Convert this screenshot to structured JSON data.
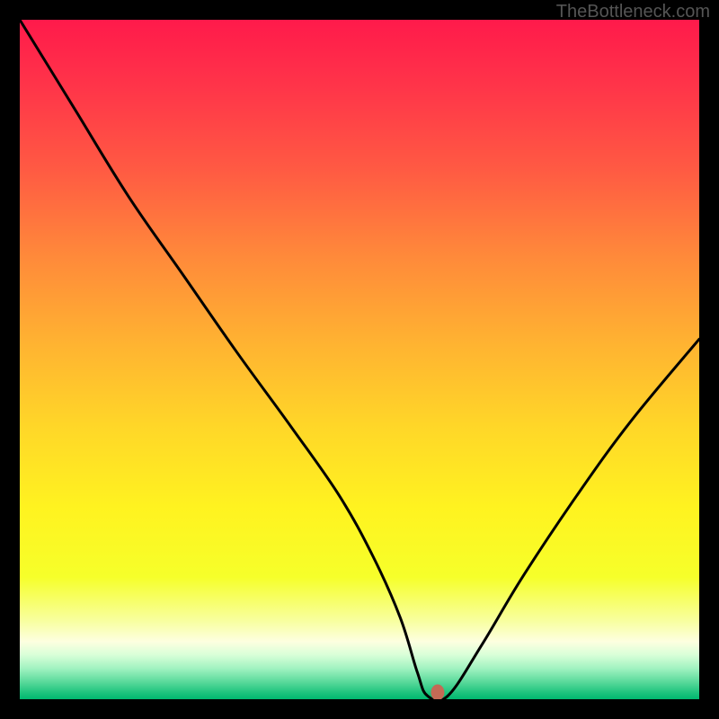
{
  "watermark": "TheBottleneck.com",
  "chart_data": {
    "type": "line",
    "title": "",
    "xlabel": "",
    "ylabel": "",
    "xlim": [
      0,
      100
    ],
    "ylim": [
      0,
      100
    ],
    "series": [
      {
        "name": "curve",
        "x": [
          0,
          8,
          16,
          24,
          32,
          40,
          47,
          52,
          56,
          58.5,
          60,
          63,
          68,
          74,
          82,
          90,
          100
        ],
        "values": [
          100,
          87,
          74,
          62.5,
          51,
          40,
          30,
          21,
          12,
          4,
          0.5,
          0.5,
          8,
          18,
          30,
          41,
          53
        ]
      }
    ],
    "marker": {
      "x": 61.5,
      "y": 1.0,
      "color": "#c46a55"
    },
    "gradient_stops": [
      {
        "offset": 0.0,
        "color": "#ff1a4b"
      },
      {
        "offset": 0.1,
        "color": "#ff3549"
      },
      {
        "offset": 0.22,
        "color": "#ff5a43"
      },
      {
        "offset": 0.35,
        "color": "#ff8a3a"
      },
      {
        "offset": 0.48,
        "color": "#ffb431"
      },
      {
        "offset": 0.6,
        "color": "#ffd728"
      },
      {
        "offset": 0.72,
        "color": "#fff320"
      },
      {
        "offset": 0.82,
        "color": "#f6ff2a"
      },
      {
        "offset": 0.885,
        "color": "#f8ffa0"
      },
      {
        "offset": 0.915,
        "color": "#fdffe0"
      },
      {
        "offset": 0.935,
        "color": "#d8ffd8"
      },
      {
        "offset": 0.955,
        "color": "#a0f2c0"
      },
      {
        "offset": 0.975,
        "color": "#58d99a"
      },
      {
        "offset": 0.99,
        "color": "#1fc47e"
      },
      {
        "offset": 1.0,
        "color": "#00b86f"
      }
    ],
    "curve_color": "#000000",
    "curve_width": 3
  }
}
